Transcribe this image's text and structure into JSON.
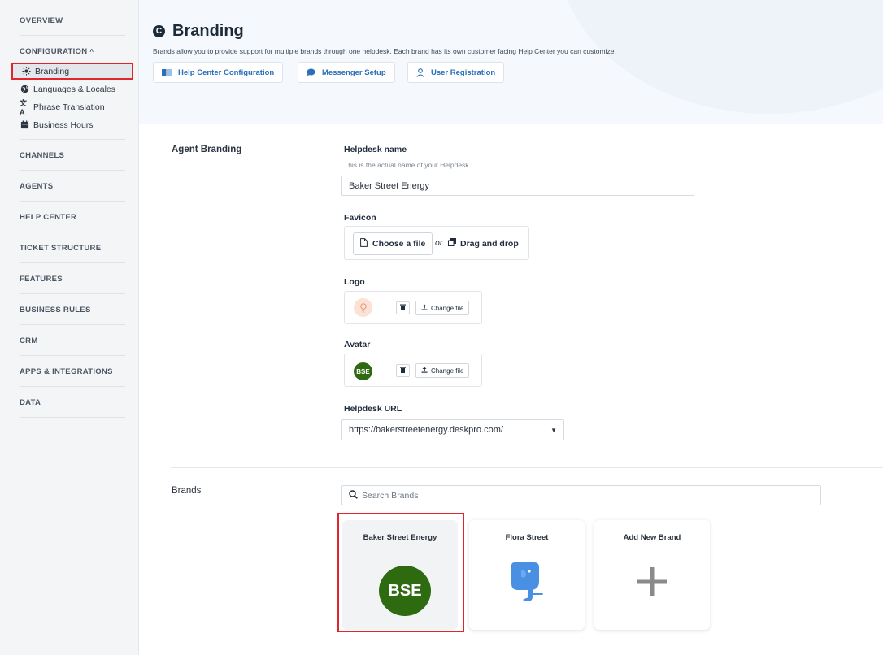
{
  "sidebar": {
    "overview": "OVERVIEW",
    "configuration": "CONFIGURATION",
    "configuration_caret": "^",
    "items": [
      {
        "label": "Branding",
        "icon": "sun-icon"
      },
      {
        "label": "Languages & Locales",
        "icon": "globe-icon"
      },
      {
        "label": "Phrase Translation",
        "icon": "translate-icon"
      },
      {
        "label": "Business Hours",
        "icon": "calendar-icon"
      }
    ],
    "sections": [
      "CHANNELS",
      "AGENTS",
      "HELP CENTER",
      "TICKET STRUCTURE",
      "FEATURES",
      "BUSINESS RULES",
      "CRM",
      "APPS & INTEGRATIONS",
      "DATA"
    ]
  },
  "header": {
    "title": "Branding",
    "title_icon_glyph": "C",
    "description": "Brands allow you to provide support for multiple brands through one helpdesk. Each brand has its own customer facing Help Center you can customize.",
    "buttons": [
      {
        "label": "Help Center Configuration",
        "icon": "book-icon"
      },
      {
        "label": "Messenger Setup",
        "icon": "chat-icon"
      },
      {
        "label": "User Registration",
        "icon": "user-icon"
      }
    ]
  },
  "agent_branding": {
    "section_label": "Agent Branding",
    "helpdesk_name_label": "Helpdesk name",
    "helpdesk_name_help": "This is the actual name of your Helpdesk",
    "helpdesk_name_value": "Baker Street Energy",
    "favicon_label": "Favicon",
    "choose_file": "Choose a file",
    "or_text": "or",
    "drag_drop": "Drag and drop",
    "logo_label": "Logo",
    "avatar_label": "Avatar",
    "avatar_initials": "BSE",
    "change_file": "Change file",
    "helpdesk_url_label": "Helpdesk URL",
    "helpdesk_url_value": "https://bakerstreetenergy.deskpro.com/"
  },
  "brands": {
    "section_label": "Brands",
    "search_placeholder": "Search Brands",
    "cards": [
      {
        "name": "Baker Street Energy",
        "initials": "BSE",
        "color": "#2e6a0f"
      },
      {
        "name": "Flora Street",
        "icon": "elephant-icon",
        "color": "#4a90e2"
      },
      {
        "name": "Add New Brand",
        "icon": "plus-icon",
        "color": "#8a8a8a"
      }
    ]
  },
  "colors": {
    "accent": "#2a6fb8",
    "highlight": "#e0252d"
  }
}
